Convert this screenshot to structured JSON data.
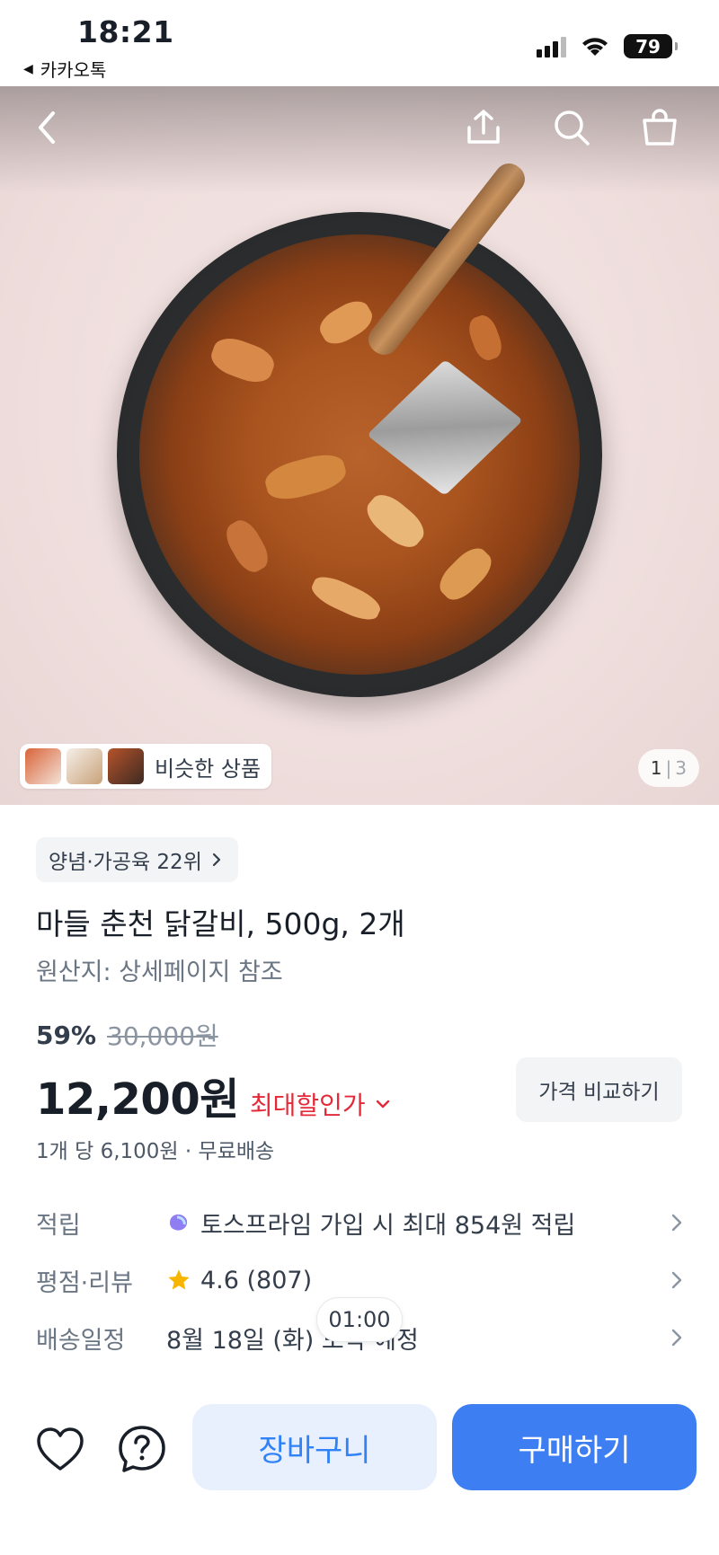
{
  "status_bar": {
    "time": "18:21",
    "back_app": "카카오톡",
    "battery": "79"
  },
  "hero": {
    "similar_label": "비슷한 상품",
    "pager_current": "1",
    "pager_separator": "|",
    "pager_total": "3"
  },
  "product": {
    "rank_chip": "양념·가공육 22위",
    "title": "마들 춘천 닭갈비, 500g, 2개",
    "origin": "원산지: 상세페이지 참조",
    "discount": "59%",
    "original_price": "30,000원",
    "price": "12,200원",
    "best_price_label": "최대할인가",
    "compare_label": "가격 비교하기",
    "unit_info": "1개 당 6,100원 · 무료배송"
  },
  "info": {
    "points_label": "적립",
    "points_value": "토스프라임 가입 시 최대 854원 적립",
    "rating_label": "평점·리뷰",
    "rating_value": "4.6 (807)",
    "delivery_label": "배송일정",
    "delivery_value": "8월 18일 (화) 도착 예정"
  },
  "timer": "01:00",
  "bottom": {
    "cart_label": "장바구니",
    "buy_label": "구매하기"
  },
  "colors": {
    "primary": "#3d7ff2",
    "cart_bg": "#e8f0fd",
    "discount_red": "#e42939",
    "star": "#f7b500"
  }
}
